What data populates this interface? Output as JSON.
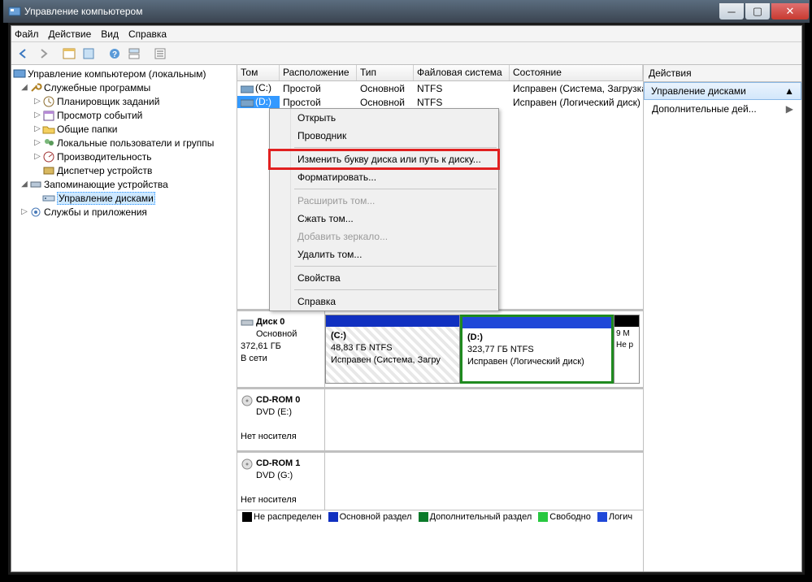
{
  "window": {
    "title": "Управление компьютером"
  },
  "menu": {
    "file": "Файл",
    "action": "Действие",
    "view": "Вид",
    "help": "Справка"
  },
  "tree": {
    "root": "Управление компьютером (локальным)",
    "system_tools": "Служебные программы",
    "task_scheduler": "Планировщик заданий",
    "event_viewer": "Просмотр событий",
    "shared_folders": "Общие папки",
    "local_users": "Локальные пользователи и группы",
    "performance": "Производительность",
    "device_mgr": "Диспетчер устройств",
    "storage": "Запоминающие устройства",
    "disk_mgmt": "Управление дисками",
    "services": "Службы и приложения"
  },
  "volumes": {
    "headers": {
      "vol": "Том",
      "layout": "Расположение",
      "type": "Тип",
      "fs": "Файловая система",
      "status": "Состояние"
    },
    "rows": [
      {
        "vol": "(C:)",
        "layout": "Простой",
        "type": "Основной",
        "fs": "NTFS",
        "status": "Исправен (Система, Загрузка, Фа"
      },
      {
        "vol": "(D:)",
        "layout": "Простой",
        "type": "Основной",
        "fs": "NTFS",
        "status": "Исправен (Логический диск)"
      }
    ]
  },
  "context": {
    "open": "Открыть",
    "explorer": "Проводник",
    "change_letter": "Изменить букву диска или путь к диску...",
    "format": "Форматировать...",
    "extend": "Расширить том...",
    "shrink": "Сжать том...",
    "mirror": "Добавить зеркало...",
    "delete": "Удалить том...",
    "props": "Свойства",
    "help": "Справка"
  },
  "graphical": {
    "disk0": {
      "title": "Диск 0",
      "type": "Основной",
      "size": "372,61 ГБ",
      "status": "В сети"
    },
    "part_c": {
      "label": "(C:)",
      "size": "48,83 ГБ NTFS",
      "status": "Исправен (Система, Загру"
    },
    "part_d": {
      "label": "(D:)",
      "size": "323,77 ГБ NTFS",
      "status": "Исправен (Логический диск)"
    },
    "part_un": {
      "l1": "9 М",
      "l2": "Не р"
    },
    "cd0": {
      "title": "CD-ROM 0",
      "sub": "DVD (E:)",
      "empty": "Нет носителя"
    },
    "cd1": {
      "title": "CD-ROM 1",
      "sub": "DVD (G:)",
      "empty": "Нет носителя"
    }
  },
  "legend": {
    "unalloc": "Не распределен",
    "primary": "Основной раздел",
    "extended": "Дополнительный раздел",
    "free": "Свободно",
    "logical": "Логич"
  },
  "actions": {
    "title": "Действия",
    "disk_mgmt": "Управление дисками",
    "more": "Дополнительные дей..."
  },
  "colors": {
    "primary": "#1030c0",
    "extended": "#0a7a2a",
    "free": "#28c840",
    "logical": "#2048d8",
    "unalloc": "#000000"
  }
}
